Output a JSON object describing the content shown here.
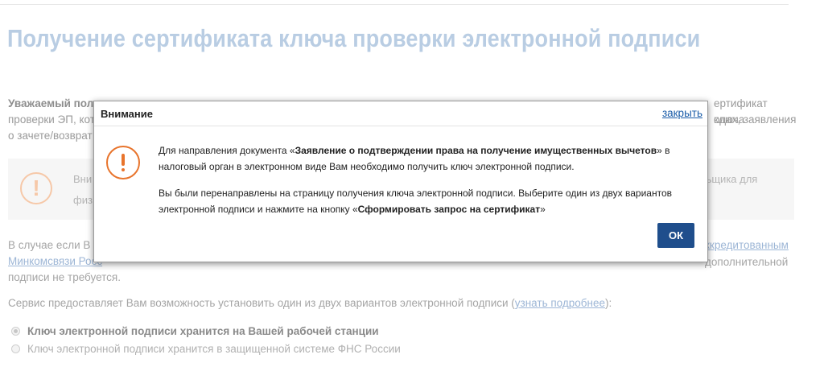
{
  "page": {
    "title": "Получение сертификата ключа проверки электронной подписи",
    "intro": {
      "greeting": "Уважаемый пол",
      "line1_tail": "ертификат ключа",
      "line2_start": "проверки ЭП, кот",
      "line2_tail": "одах, заявления",
      "line3_start": "о зачете/возврат"
    },
    "info_box": {
      "text_start": "Вни",
      "text_tail": "льщика для",
      "text_line2": "физ"
    },
    "para2": {
      "start": "В случае если В",
      "link_start": "Минкомсвязи Росс",
      "link_tail": "ккредитованным",
      "tail2": "дополнительной",
      "line3": "подписи не требуется."
    },
    "service": {
      "text": "Сервис предоставляет Вам возможность установить один из двух вариантов электронной подписи (",
      "link": "узнать подробнее",
      "suffix": "):"
    },
    "options": [
      {
        "label": "Ключ электронной подписи хранится на Вашей рабочей станции",
        "selected": true
      },
      {
        "label": "Ключ электронной подписи хранится в защищенной системе ФНС России",
        "selected": false
      }
    ]
  },
  "modal": {
    "title": "Внимание",
    "close_label": "закрыть",
    "para1": {
      "prefix": "Для направления документа «",
      "bold": "Заявление о подтверждении права на получение имущественных вычетов",
      "suffix": "» в налоговый орган в электронном виде Вам необходимо получить ключ электронной подписи."
    },
    "para2": {
      "prefix": "Вы были перенаправлены на страницу получения ключа электронной подписи. Выберите один из двух вариантов электронной подписи и нажмите на кнопку «",
      "bold": "Сформировать запрос на сертификат",
      "suffix": "»"
    },
    "ok_label": "ОК",
    "icon": "warning-exclamation-icon"
  },
  "colors": {
    "accent": "#1f4e8c",
    "warning": "#e8742c",
    "link": "#1a5ca8"
  }
}
